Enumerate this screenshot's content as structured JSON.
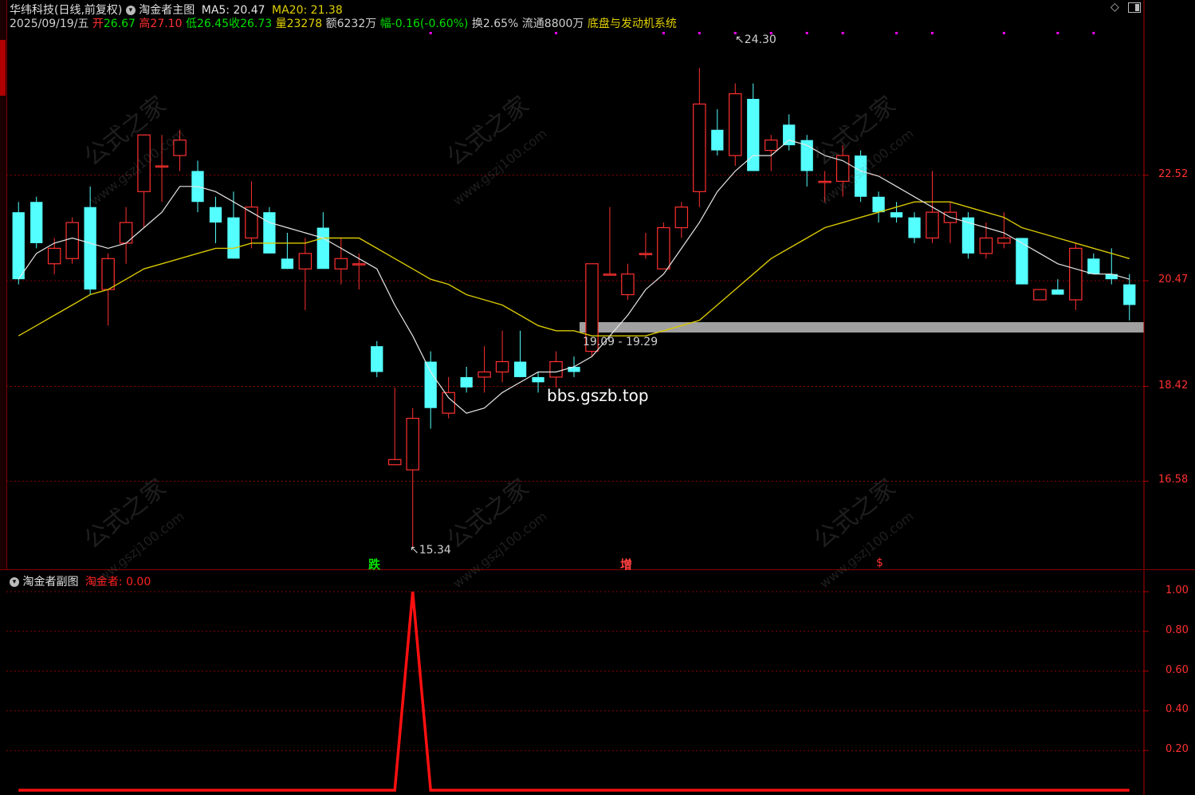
{
  "header": {
    "stock_name": "华纬科技",
    "period": "(日线,前复权)",
    "main_indicator": "淘金者主图",
    "ma5_label": "MA5:",
    "ma5_value": "20.47",
    "ma20_label": "MA20:",
    "ma20_value": "21.38",
    "date": "2025/09/19/五",
    "open_label": "开",
    "open": "26.67",
    "high_label": "高",
    "high": "27.10",
    "low_label": "低",
    "low": "26.45",
    "close_label": "收",
    "close": "26.73",
    "volume_label": "量",
    "volume": "23278",
    "amount_label": "额",
    "amount": "6232万",
    "change_label": "幅",
    "change": "-0.16(-0.60%)",
    "turnover_label": "换",
    "turnover": "2.65%",
    "float_label": "流通",
    "float": "8800万",
    "system_name": "底盘与发动机系统"
  },
  "sub_header": {
    "title": "淘金者副图",
    "series_label": "淘金者:",
    "series_value": "0.00"
  },
  "annotations": {
    "high_marker": "24.30",
    "low_marker": "15.34",
    "range_label": "19.09 - 19.29",
    "signal_fall": "跌",
    "signal_increase": "增",
    "signal_dollar": "$",
    "watermark_url": "bbs.gszb.top"
  },
  "watermarks": {
    "brand": "公式之家",
    "url": "www.gszj100.com"
  },
  "colors": {
    "up": "#ff3030",
    "down": "#54ffff",
    "ma5": "#e6e6e6",
    "ma20": "#d8c800",
    "grid": "#8a0000",
    "support_band": "#a0a0a0",
    "sub_line": "#ff1010"
  },
  "chart_data": [
    {
      "type": "candlestick",
      "title": "淘金者主图",
      "y_ticks": [
        "22.52",
        "20.47",
        "18.42",
        "16.58"
      ],
      "y_tick_values": [
        22.52,
        20.47,
        18.42,
        16.58
      ],
      "ylim": [
        14.9,
        25.3
      ],
      "support_band": [
        19.09,
        19.29
      ],
      "candles": [
        {
          "o": 21.8,
          "h": 22.0,
          "l": 20.4,
          "c": 20.5
        },
        {
          "o": 22.0,
          "h": 22.1,
          "l": 21.1,
          "c": 21.2
        },
        {
          "o": 20.8,
          "h": 21.3,
          "l": 20.6,
          "c": 21.1
        },
        {
          "o": 20.9,
          "h": 21.7,
          "l": 20.8,
          "c": 21.6
        },
        {
          "o": 21.9,
          "h": 22.3,
          "l": 20.2,
          "c": 20.3
        },
        {
          "o": 20.3,
          "h": 21.0,
          "l": 19.6,
          "c": 20.9
        },
        {
          "o": 21.2,
          "h": 21.9,
          "l": 20.8,
          "c": 21.6
        },
        {
          "o": 22.2,
          "h": 23.2,
          "l": 21.5,
          "c": 23.3
        },
        {
          "o": 22.7,
          "h": 23.3,
          "l": 22.0,
          "c": 22.7
        },
        {
          "o": 22.9,
          "h": 23.4,
          "l": 22.6,
          "c": 23.2
        },
        {
          "o": 22.6,
          "h": 22.8,
          "l": 21.8,
          "c": 22.0
        },
        {
          "o": 21.9,
          "h": 22.1,
          "l": 21.2,
          "c": 21.6
        },
        {
          "o": 21.7,
          "h": 22.2,
          "l": 20.9,
          "c": 20.9
        },
        {
          "o": 21.3,
          "h": 22.4,
          "l": 21.1,
          "c": 21.9
        },
        {
          "o": 21.8,
          "h": 21.9,
          "l": 21.0,
          "c": 21.0
        },
        {
          "o": 20.9,
          "h": 21.4,
          "l": 20.7,
          "c": 20.7
        },
        {
          "o": 20.7,
          "h": 21.3,
          "l": 19.9,
          "c": 21.0
        },
        {
          "o": 21.5,
          "h": 21.8,
          "l": 20.7,
          "c": 20.7
        },
        {
          "o": 20.7,
          "h": 21.3,
          "l": 20.4,
          "c": 20.9
        },
        {
          "o": 20.8,
          "h": 21.0,
          "l": 20.3,
          "c": 20.8
        },
        {
          "o": 19.2,
          "h": 19.3,
          "l": 18.6,
          "c": 18.7
        },
        {
          "o": 16.9,
          "h": 18.4,
          "l": 16.9,
          "c": 17.0
        },
        {
          "o": 16.8,
          "h": 18.0,
          "l": 15.3,
          "c": 17.8
        },
        {
          "o": 18.9,
          "h": 19.1,
          "l": 17.6,
          "c": 18.0
        },
        {
          "o": 17.9,
          "h": 18.6,
          "l": 17.8,
          "c": 18.3
        },
        {
          "o": 18.6,
          "h": 18.8,
          "l": 18.3,
          "c": 18.4
        },
        {
          "o": 18.6,
          "h": 19.2,
          "l": 18.3,
          "c": 18.7
        },
        {
          "o": 18.7,
          "h": 19.5,
          "l": 18.5,
          "c": 18.9
        },
        {
          "o": 18.9,
          "h": 19.5,
          "l": 18.6,
          "c": 18.6
        },
        {
          "o": 18.6,
          "h": 18.7,
          "l": 18.3,
          "c": 18.5
        },
        {
          "o": 18.6,
          "h": 19.1,
          "l": 18.4,
          "c": 18.9
        },
        {
          "o": 18.8,
          "h": 19.0,
          "l": 18.6,
          "c": 18.7
        },
        {
          "o": 19.1,
          "h": 20.8,
          "l": 19.0,
          "c": 20.8
        },
        {
          "o": 20.6,
          "h": 21.9,
          "l": 20.6,
          "c": 20.6
        },
        {
          "o": 20.2,
          "h": 20.8,
          "l": 20.1,
          "c": 20.6
        },
        {
          "o": 21.0,
          "h": 21.4,
          "l": 20.9,
          "c": 21.0
        },
        {
          "o": 20.7,
          "h": 21.6,
          "l": 20.7,
          "c": 21.5
        },
        {
          "o": 21.5,
          "h": 22.0,
          "l": 21.3,
          "c": 21.9
        },
        {
          "o": 22.2,
          "h": 24.6,
          "l": 21.9,
          "c": 23.9
        },
        {
          "o": 23.4,
          "h": 23.8,
          "l": 22.9,
          "c": 23.0
        },
        {
          "o": 22.9,
          "h": 24.3,
          "l": 22.7,
          "c": 24.1
        },
        {
          "o": 24.0,
          "h": 24.3,
          "l": 22.6,
          "c": 22.6
        },
        {
          "o": 23.0,
          "h": 23.3,
          "l": 22.6,
          "c": 23.2
        },
        {
          "o": 23.5,
          "h": 23.7,
          "l": 23.0,
          "c": 23.1
        },
        {
          "o": 23.2,
          "h": 23.3,
          "l": 22.3,
          "c": 22.6
        },
        {
          "o": 22.4,
          "h": 22.6,
          "l": 22.0,
          "c": 22.4
        },
        {
          "o": 22.4,
          "h": 23.1,
          "l": 22.1,
          "c": 22.9
        },
        {
          "o": 22.9,
          "h": 23.0,
          "l": 22.0,
          "c": 22.1
        },
        {
          "o": 22.1,
          "h": 22.2,
          "l": 21.6,
          "c": 21.8
        },
        {
          "o": 21.8,
          "h": 22.0,
          "l": 21.6,
          "c": 21.7
        },
        {
          "o": 21.7,
          "h": 21.8,
          "l": 21.2,
          "c": 21.3
        },
        {
          "o": 21.3,
          "h": 22.6,
          "l": 21.2,
          "c": 21.8
        },
        {
          "o": 21.6,
          "h": 22.0,
          "l": 21.2,
          "c": 21.8
        },
        {
          "o": 21.7,
          "h": 21.8,
          "l": 20.9,
          "c": 21.0
        },
        {
          "o": 21.0,
          "h": 21.6,
          "l": 20.9,
          "c": 21.3
        },
        {
          "o": 21.2,
          "h": 21.8,
          "l": 21.1,
          "c": 21.3
        },
        {
          "o": 21.3,
          "h": 21.3,
          "l": 20.4,
          "c": 20.4
        },
        {
          "o": 20.1,
          "h": 20.3,
          "l": 20.1,
          "c": 20.3
        },
        {
          "o": 20.3,
          "h": 20.5,
          "l": 20.2,
          "c": 20.2
        },
        {
          "o": 20.1,
          "h": 21.2,
          "l": 19.9,
          "c": 21.1
        },
        {
          "o": 20.9,
          "h": 21.0,
          "l": 20.6,
          "c": 20.6
        },
        {
          "o": 20.6,
          "h": 21.1,
          "l": 20.4,
          "c": 20.5
        },
        {
          "o": 20.4,
          "h": 20.6,
          "l": 19.7,
          "c": 20.0
        }
      ],
      "ma5": [
        20.5,
        21.0,
        21.2,
        21.3,
        21.2,
        21.1,
        21.2,
        21.5,
        21.8,
        22.3,
        22.3,
        22.2,
        22.0,
        21.8,
        21.6,
        21.5,
        21.4,
        21.3,
        21.1,
        20.9,
        20.7,
        20.0,
        19.4,
        18.7,
        18.2,
        17.9,
        18.0,
        18.3,
        18.5,
        18.7,
        18.7,
        18.8,
        19.0,
        19.4,
        19.8,
        20.3,
        20.6,
        21.1,
        21.6,
        22.2,
        22.6,
        22.9,
        22.9,
        23.2,
        23.1,
        22.9,
        22.8,
        22.6,
        22.5,
        22.3,
        22.1,
        21.9,
        21.7,
        21.6,
        21.5,
        21.4,
        21.2,
        21.0,
        20.8,
        20.7,
        20.6,
        20.6,
        20.5
      ],
      "ma20": [
        19.4,
        19.6,
        19.8,
        20.0,
        20.2,
        20.3,
        20.5,
        20.7,
        20.8,
        20.9,
        21.0,
        21.1,
        21.1,
        21.2,
        21.2,
        21.2,
        21.2,
        21.3,
        21.3,
        21.3,
        21.1,
        20.9,
        20.7,
        20.5,
        20.4,
        20.2,
        20.1,
        20.0,
        19.8,
        19.6,
        19.5,
        19.5,
        19.4,
        19.4,
        19.4,
        19.4,
        19.5,
        19.6,
        19.7,
        20.0,
        20.3,
        20.6,
        20.9,
        21.1,
        21.3,
        21.5,
        21.6,
        21.7,
        21.8,
        21.9,
        22.0,
        22.0,
        22.0,
        21.9,
        21.8,
        21.7,
        21.5,
        21.4,
        21.3,
        21.2,
        21.1,
        21.0,
        20.9
      ]
    },
    {
      "type": "line",
      "title": "淘金者副图",
      "y_ticks": [
        "1.00",
        "0.80",
        "0.60",
        "0.40",
        "0.20"
      ],
      "y_tick_values": [
        1.0,
        0.8,
        0.6,
        0.4,
        0.2
      ],
      "ylim": [
        0,
        1.0
      ],
      "series": [
        {
          "name": "淘金者",
          "x_index_peak": 22,
          "values": [
            0,
            0,
            0,
            0,
            0,
            0,
            0,
            0,
            0,
            0,
            0,
            0,
            0,
            0,
            0,
            0,
            0,
            0,
            0,
            0,
            0,
            0,
            1,
            0,
            0,
            0,
            0,
            0,
            0,
            0,
            0,
            0,
            0,
            0,
            0,
            0,
            0,
            0,
            0,
            0,
            0,
            0,
            0,
            0,
            0,
            0,
            0,
            0,
            0,
            0,
            0,
            0,
            0,
            0,
            0,
            0,
            0,
            0,
            0,
            0,
            0,
            0,
            0
          ]
        }
      ]
    }
  ]
}
